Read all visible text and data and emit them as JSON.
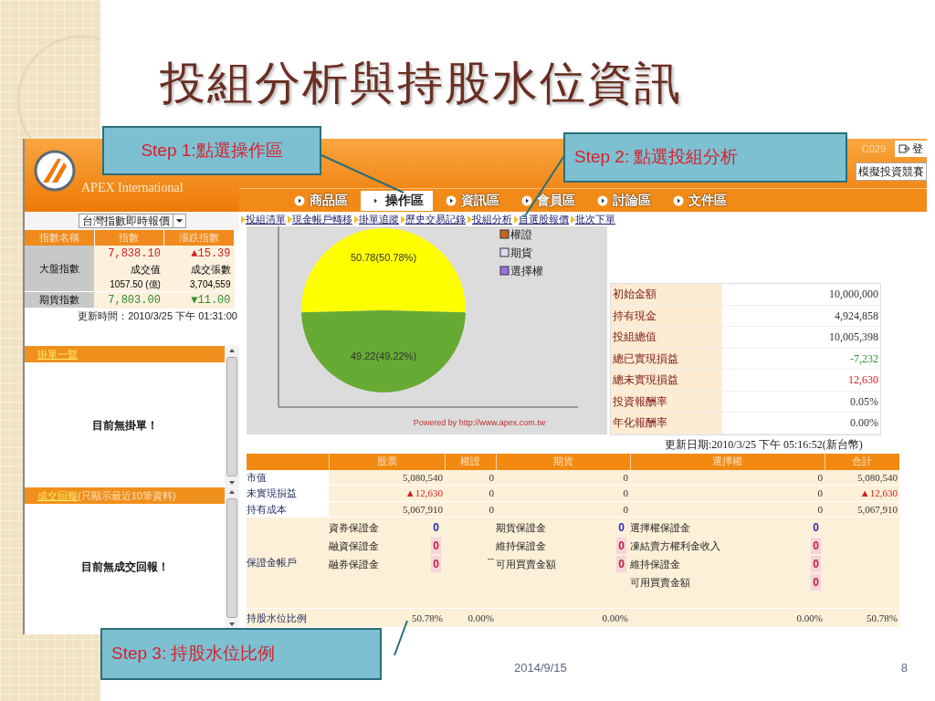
{
  "slide": {
    "title": "投組分析與持股水位資訊",
    "date": "2014/9/15",
    "page_number": "8"
  },
  "callouts": [
    {
      "text": "Step 1:點選操作區"
    },
    {
      "text": "Step 2: 點選投組分析"
    },
    {
      "text": "Step 3: 持股水位比例"
    }
  ],
  "header": {
    "brand": "APEX International",
    "account": "C029",
    "logout": "登",
    "contest": "模擬投資競賽"
  },
  "nav_tabs": [
    {
      "label": "商品區",
      "selected": false
    },
    {
      "label": "操作區",
      "selected": true
    },
    {
      "label": "資訊區",
      "selected": false
    },
    {
      "label": "會員區",
      "selected": false
    },
    {
      "label": "討論區",
      "selected": false
    },
    {
      "label": "文件區",
      "selected": false
    }
  ],
  "index_panel": {
    "dropdown": "台灣指數即時報價",
    "columns": [
      "指數名稱",
      "指數",
      "漲跌指數"
    ],
    "rows": [
      {
        "name": "大盤指數",
        "index": "7,838.10",
        "change": "▲15.39",
        "color": "#d42020",
        "volume_label": "成交值",
        "volume": "1057.50 (億)",
        "shares_label": "成交張數",
        "shares": "3,704,559"
      },
      {
        "name": "期貨指數",
        "index": "7,803.00",
        "change": "▼11.00",
        "color": "#2f8f2f"
      }
    ],
    "updated": "更新時間：2010/3/25 下午 01:31:00"
  },
  "order_panels": [
    {
      "title": "掛單一覽",
      "message": "目前無掛單！"
    },
    {
      "title": "成交回報",
      "note": "(只顯示最近10筆資料)",
      "message": "目前無成交回報！"
    }
  ],
  "sub_links": [
    "投組清單",
    "現金帳戶轉移",
    "掛單追蹤",
    "歷史交易記錄",
    "投組分析",
    "自選股報價",
    "批次下單"
  ],
  "chart": {
    "chart_data": {
      "type": "pie",
      "values": [
        50.78,
        49.22
      ],
      "value_labels": [
        "50.78(50.78%)",
        "49.22(49.22%)"
      ]
    },
    "legend": [
      {
        "label": "權證",
        "color": "#c8641e"
      },
      {
        "label": "期貨",
        "color": "#dcdcf8"
      },
      {
        "label": "選擇權",
        "color": "#9a70e0"
      }
    ],
    "credit": "Powered by http://www.apex.com.tw"
  },
  "summary": [
    {
      "label": "初始金額",
      "value": "10,000,000"
    },
    {
      "label": "持有現金",
      "value": "4,924,858"
    },
    {
      "label": "投組總值",
      "value": "10,005,398"
    },
    {
      "label": "總已實現損益",
      "value": "-7,232",
      "color": "#2f8f2f"
    },
    {
      "label": "總未實現損益",
      "value": "12,630",
      "color": "#d42020"
    },
    {
      "label": "投資報酬率",
      "value": "0.05%"
    },
    {
      "label": "年化報酬率",
      "value": "0.00%"
    }
  ],
  "summary_updated": "更新日期:2010/3/25 下午 05:16:52(新台幣)",
  "holdings": {
    "columns": [
      "股票",
      "權證",
      "期貨",
      "選擇權",
      "合計"
    ],
    "rows": [
      {
        "label": "市值",
        "cells": [
          {
            "value": "5,080,540"
          },
          {
            "value": "0"
          },
          {
            "value": "0"
          },
          {
            "value": "0"
          },
          {
            "value": "5,080,540"
          }
        ]
      },
      {
        "label": "未實現損益",
        "cells": [
          {
            "value": "▲12,630",
            "color": "#d42020"
          },
          {
            "value": "0"
          },
          {
            "value": "0"
          },
          {
            "value": "0"
          },
          {
            "value": "▲12,630",
            "color": "#d42020"
          }
        ]
      },
      {
        "label": "持有成本",
        "cells": [
          {
            "value": "5,067,910"
          },
          {
            "value": "0"
          },
          {
            "value": "0"
          },
          {
            "value": "0"
          },
          {
            "value": "5,067,910"
          }
        ]
      }
    ],
    "margin": {
      "label": "保證金帳戶",
      "stock": [
        {
          "label": "資券保證金",
          "value": "0",
          "color": "#2828c0",
          "highlighted": false
        },
        {
          "label": "融資保證金",
          "value": "0",
          "color": "#c02040",
          "highlighted": true
        },
        {
          "label": "融券保證金",
          "value": "0",
          "color": "#c02040",
          "highlighted": true
        }
      ],
      "warrant": "--",
      "futures": [
        {
          "label": "期貨保證金",
          "value": "0",
          "color": "#2828c0",
          "highlighted": false
        },
        {
          "label": "維持保證金",
          "value": "0",
          "color": "#c02040",
          "highlighted": true
        },
        {
          "label": "可用買賣金額",
          "value": "0",
          "color": "#c02040",
          "highlighted": true
        }
      ],
      "options": [
        {
          "label": "選擇權保證金",
          "value": "0",
          "color": "#2828c0",
          "highlighted": false
        },
        {
          "label": "凍結賣方權利金收入",
          "value": "0",
          "color": "#c02040",
          "highlighted": true
        },
        {
          "label": "維持保證金",
          "value": "0",
          "color": "#c02040",
          "highlighted": true
        },
        {
          "label": "可用買賣金額",
          "value": "0",
          "color": "#c02040",
          "highlighted": true
        }
      ]
    },
    "ratio": {
      "label": "持股水位比例",
      "cells": [
        "50.78%",
        "0.00%",
        "0.00%",
        "0.00%",
        "50.78%"
      ]
    }
  }
}
